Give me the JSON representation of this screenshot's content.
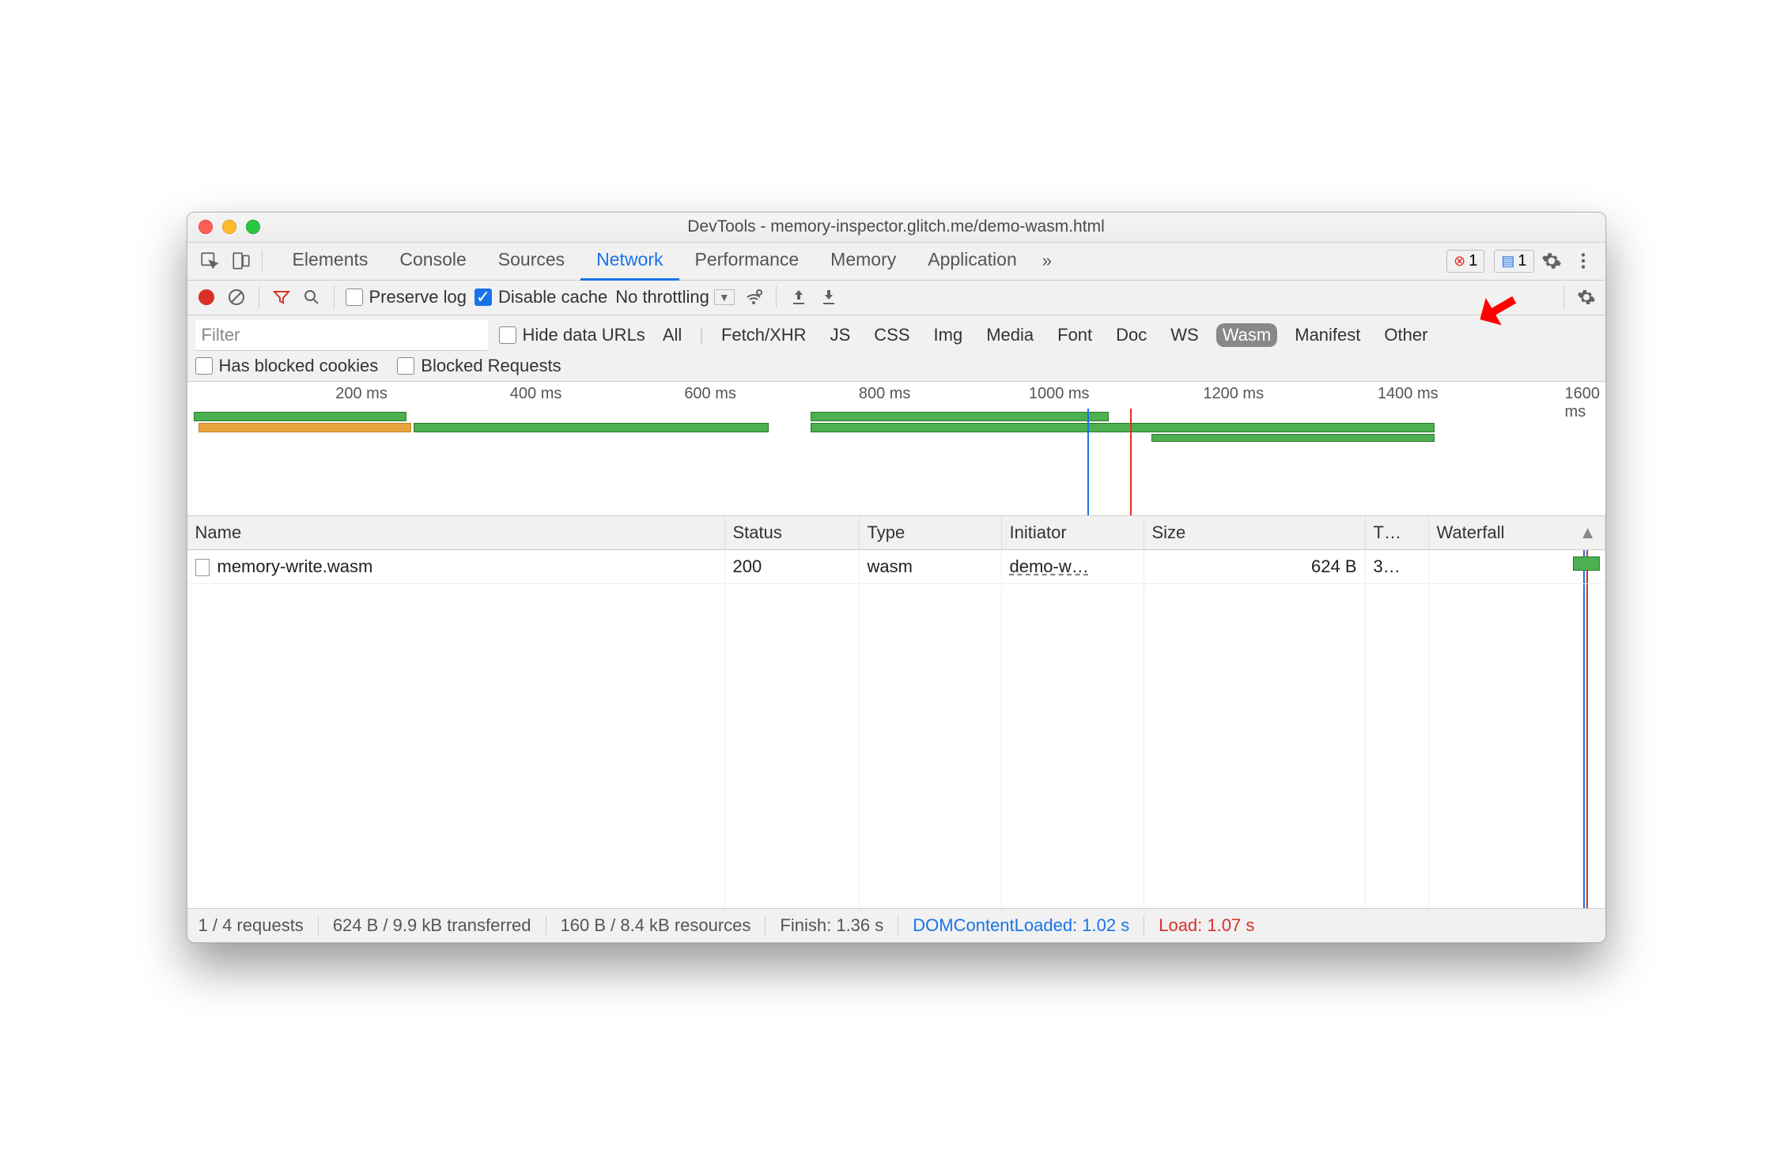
{
  "window_title": "DevTools - memory-inspector.glitch.me/demo-wasm.html",
  "tabs": [
    "Elements",
    "Console",
    "Sources",
    "Network",
    "Performance",
    "Memory",
    "Application"
  ],
  "active_tab": "Network",
  "badges": {
    "errors": "1",
    "messages": "1"
  },
  "toolbar": {
    "preserve_log": "Preserve log",
    "disable_cache": "Disable cache",
    "throttle": "No throttling"
  },
  "filter": {
    "placeholder": "Filter",
    "hide_data_urls": "Hide data URLs",
    "types": [
      "All",
      "Fetch/XHR",
      "JS",
      "CSS",
      "Img",
      "Media",
      "Font",
      "Doc",
      "WS",
      "Wasm",
      "Manifest",
      "Other"
    ],
    "active_type": "Wasm",
    "has_blocked_cookies": "Has blocked cookies",
    "blocked_requests": "Blocked Requests"
  },
  "timeline": {
    "ticks": [
      "200 ms",
      "400 ms",
      "600 ms",
      "800 ms",
      "1000 ms",
      "1200 ms",
      "1400 ms",
      "1600 ms"
    ]
  },
  "columns": {
    "name": "Name",
    "status": "Status",
    "type": "Type",
    "initiator": "Initiator",
    "size": "Size",
    "time": "T…",
    "waterfall": "Waterfall"
  },
  "rows": [
    {
      "name": "memory-write.wasm",
      "status": "200",
      "type": "wasm",
      "initiator": "demo-w…",
      "size": "624 B",
      "time": "3…"
    }
  ],
  "status": {
    "requests": "1 / 4 requests",
    "transferred": "624 B / 9.9 kB transferred",
    "resources": "160 B / 8.4 kB resources",
    "finish": "Finish: 1.36 s",
    "dcl": "DOMContentLoaded: 1.02 s",
    "load": "Load: 1.07 s"
  }
}
